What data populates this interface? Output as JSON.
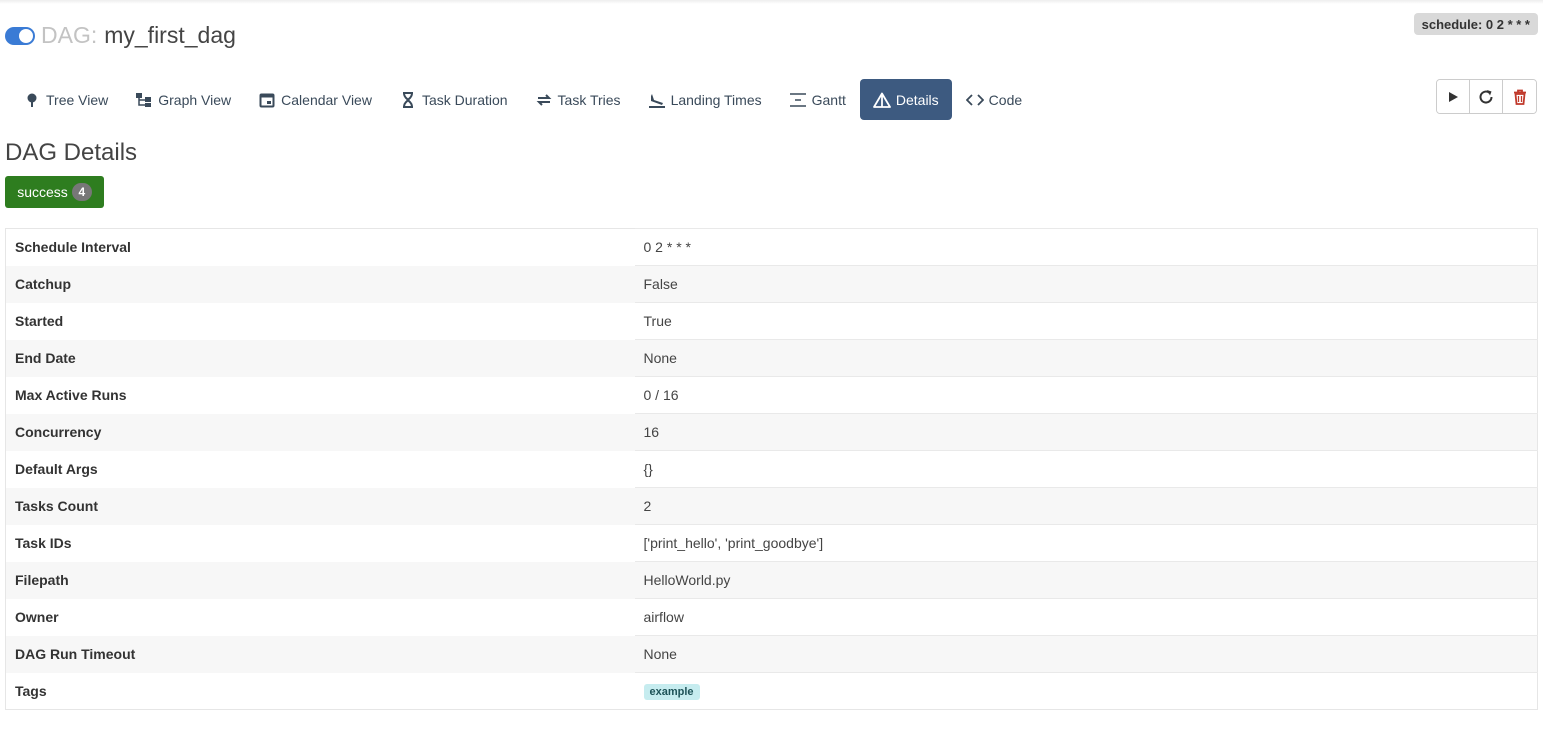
{
  "header": {
    "dag_prefix": "DAG:",
    "dag_id": "my_first_dag",
    "schedule_badge": "schedule: 0 2 * * *",
    "toggle_on": true
  },
  "tabs": [
    {
      "label": "Tree View",
      "icon": "tree-icon"
    },
    {
      "label": "Graph View",
      "icon": "graph-icon"
    },
    {
      "label": "Calendar View",
      "icon": "calendar-icon"
    },
    {
      "label": "Task Duration",
      "icon": "hourglass-icon"
    },
    {
      "label": "Task Tries",
      "icon": "repeat-icon"
    },
    {
      "label": "Landing Times",
      "icon": "plane-landing-icon"
    },
    {
      "label": "Gantt",
      "icon": "gantt-icon"
    },
    {
      "label": "Details",
      "icon": "warning-triangle-icon",
      "active": true
    },
    {
      "label": "Code",
      "icon": "code-icon"
    }
  ],
  "actions": [
    {
      "name": "trigger-dag-button",
      "icon": "play-icon"
    },
    {
      "name": "refresh-button",
      "icon": "refresh-icon"
    },
    {
      "name": "delete-dag-button",
      "icon": "trash-icon"
    }
  ],
  "page_title": "DAG Details",
  "state": {
    "label": "success",
    "count": "4",
    "color": "#2e7d1f"
  },
  "details": [
    {
      "key": "Schedule Interval",
      "value": "0 2 * * *"
    },
    {
      "key": "Catchup",
      "value": "False"
    },
    {
      "key": "Started",
      "value": "True"
    },
    {
      "key": "End Date",
      "value": "None"
    },
    {
      "key": "Max Active Runs",
      "value": "0 / 16"
    },
    {
      "key": "Concurrency",
      "value": "16"
    },
    {
      "key": "Default Args",
      "value": "{}"
    },
    {
      "key": "Tasks Count",
      "value": "2"
    },
    {
      "key": "Task IDs",
      "value": "['print_hello', 'print_goodbye']"
    },
    {
      "key": "Filepath",
      "value": "HelloWorld.py"
    },
    {
      "key": "Owner",
      "value": "airflow"
    },
    {
      "key": "DAG Run Timeout",
      "value": "None"
    },
    {
      "key": "Tags",
      "value": "example"
    }
  ],
  "colors": {
    "active_tab": "#3d5a80",
    "toggle": "#3a7bd5",
    "tag_bg": "#c6ecef",
    "delete": "#c0392b"
  }
}
